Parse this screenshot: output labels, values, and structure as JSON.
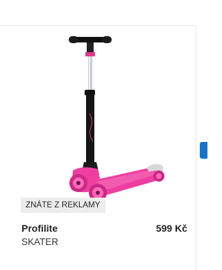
{
  "product": {
    "ad_badge": "ZNÁTE Z REKLAMY",
    "name": "Profilite",
    "category": "SKATER",
    "price": "599 Kč"
  },
  "colors": {
    "scooter_deck": "#ee3fa0",
    "scooter_stem": "#111111",
    "nav_accent": "#1a73c8"
  },
  "icons": {
    "next": "chevron-right-icon"
  }
}
